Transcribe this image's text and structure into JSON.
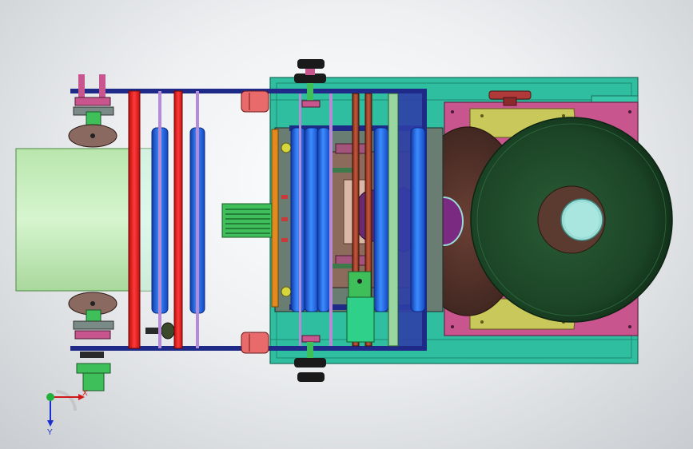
{
  "view": {
    "triad": {
      "x_label": "X",
      "y_label": "Y"
    }
  },
  "colors": {
    "teal_frame": "#2fbfa0",
    "pink_plate": "#c8558e",
    "yellow_bracket": "#c9c85a",
    "dark_green_drum": "#1f4a2b",
    "light_green_roll": "#c4ecba",
    "blue_roller": "#1e5fe0",
    "red_roller": "#e82020",
    "brown_roller": "#a4402a",
    "navy_bar": "#1f2a88",
    "orange_strip": "#e38a1e",
    "purple_hub": "#7a2a80",
    "cyan_ring": "#9adcd6"
  }
}
